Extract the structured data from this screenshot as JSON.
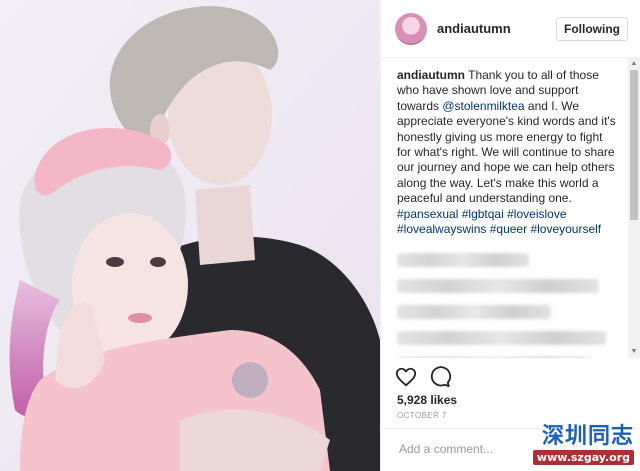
{
  "post": {
    "username": "andiautumn",
    "follow_label": "Following",
    "caption": {
      "username": "andiautumn",
      "part1": " Thank you to all of those who have shown love and support towards ",
      "mention": "@stolenmilktea",
      "part2": " and I. We appreciate everyone's kind words and it's honestly giving us more energy to fight for what's right. We will continue to share our journey and hope we can help others along the way. Let's make this world a peaceful and understanding one. ",
      "hashtags": [
        "#pansexual",
        "#lgbtqai",
        "#loveislove",
        "#lovealwayswins",
        "#queer",
        "#loveyourself"
      ]
    },
    "likes": "5,928 likes",
    "date": "OCTOBER 7",
    "comment_placeholder": "Add a comment...",
    "more_icon": "ellipsis-icon"
  },
  "icons": {
    "like": "heart-outline-icon",
    "comment": "speech-bubble-icon"
  },
  "watermark": {
    "title": "深圳同志",
    "url": "www.szgay.org"
  },
  "colors": {
    "link": "#003569",
    "watermark_blue": "#1d5fb5",
    "watermark_red": "#ad2f36"
  }
}
